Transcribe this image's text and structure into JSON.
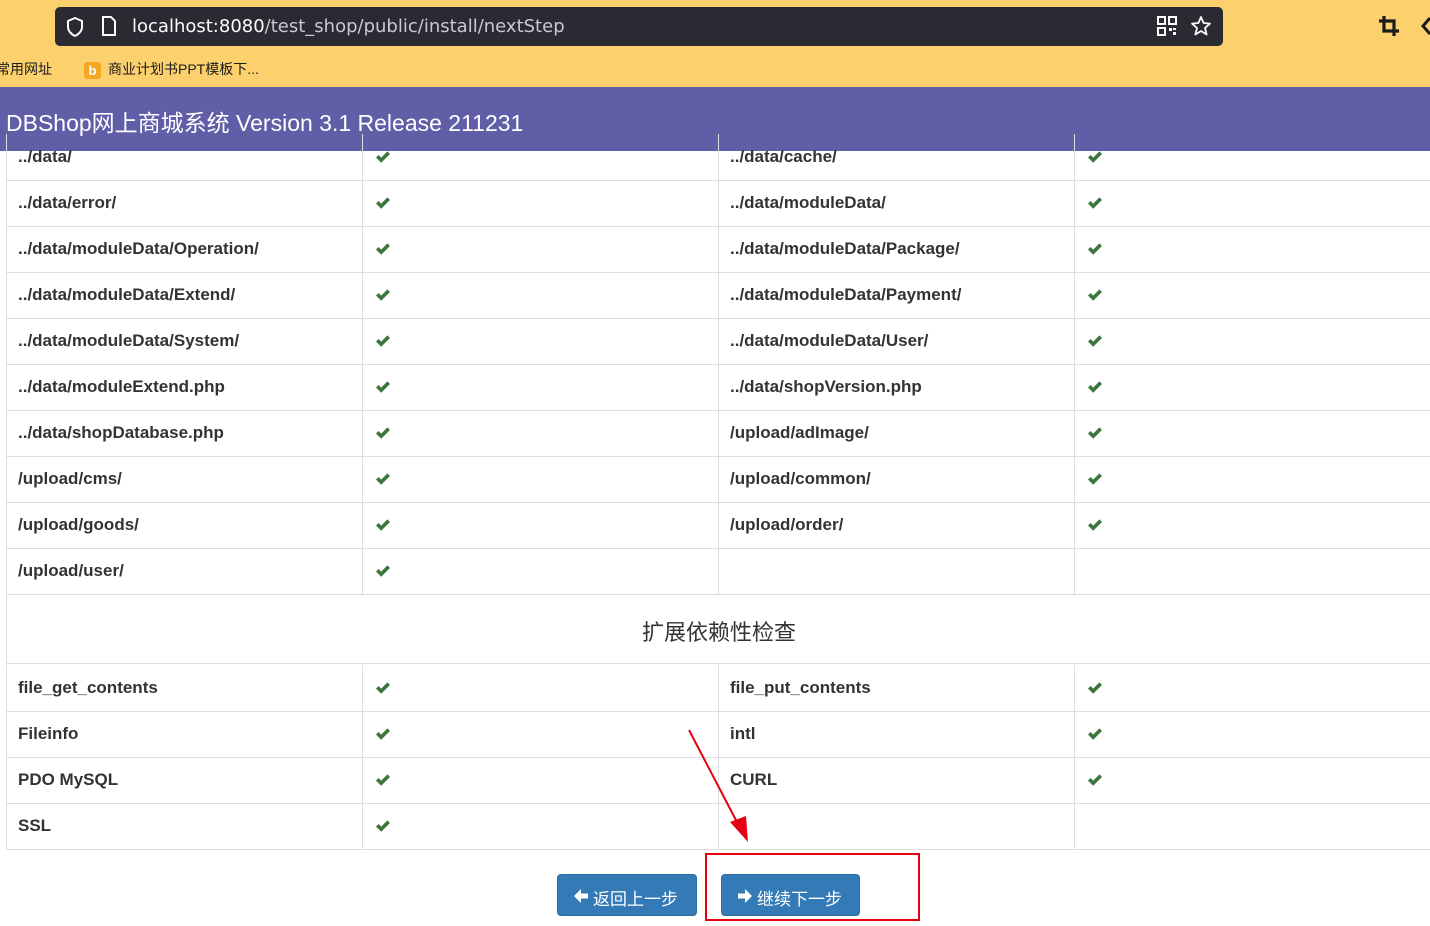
{
  "browser": {
    "url_host": "localhost:8080",
    "url_path": "/test_shop/public/install/nextStep",
    "bookmarks": [
      "常用网址",
      "商业计划书PPT模板下..."
    ],
    "bookmark_favicon_letter": "b"
  },
  "header": {
    "title": "DBShop网上商城系统 Version 3.1 Release 211231"
  },
  "dir_rows": [
    {
      "left": "../data/",
      "right": "../data/cache/"
    },
    {
      "left": "../data/error/",
      "right": "../data/moduleData/"
    },
    {
      "left": "../data/moduleData/Operation/",
      "right": "../data/moduleData/Package/"
    },
    {
      "left": "../data/moduleData/Extend/",
      "right": "../data/moduleData/Payment/"
    },
    {
      "left": "../data/moduleData/System/",
      "right": "../data/moduleData/User/"
    },
    {
      "left": "../data/moduleExtend.php",
      "right": "../data/shopVersion.php"
    },
    {
      "left": "../data/shopDatabase.php",
      "right": "/upload/adImage/"
    },
    {
      "left": "/upload/cms/",
      "right": "/upload/common/"
    },
    {
      "left": "/upload/goods/",
      "right": "/upload/order/"
    },
    {
      "left": "/upload/user/",
      "right": ""
    }
  ],
  "section_title": "扩展依赖性检查",
  "ext_rows": [
    {
      "left": "file_get_contents",
      "right": "file_put_contents"
    },
    {
      "left": "Fileinfo",
      "right": "intl"
    },
    {
      "left": "PDO MySQL",
      "right": "CURL"
    },
    {
      "left": "SSL",
      "right": ""
    }
  ],
  "buttons": {
    "back": "返回上一步",
    "next": "继续下一步"
  },
  "colors": {
    "header_bg": "#615ea8",
    "check": "#3c763d",
    "button": "#337ab7",
    "annotation": "#e60012"
  }
}
